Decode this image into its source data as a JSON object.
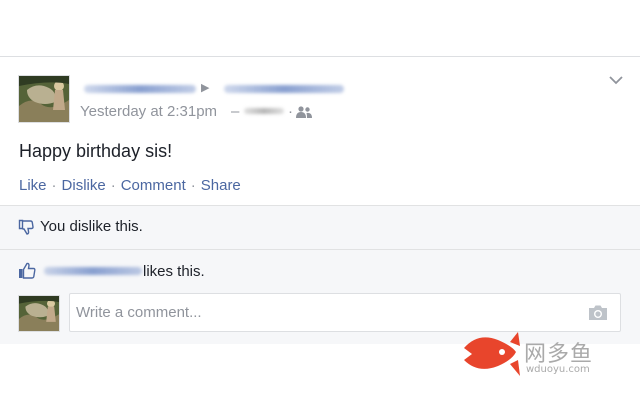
{
  "post": {
    "timestamp": "Yesterday at 2:31pm",
    "dash": "–",
    "dot": "·",
    "text": "Happy birthday sis!",
    "actions": {
      "like": "Like",
      "dislike": "Dislike",
      "comment": "Comment",
      "share": "Share",
      "separator": "·"
    }
  },
  "reactions": {
    "dislike_text": "You dislike this.",
    "likes_suffix": "likes this."
  },
  "comment": {
    "placeholder": "Write a comment..."
  },
  "watermark": {
    "cn": "网多鱼",
    "en": "wduoyu.com"
  },
  "colors": {
    "link": "#4b67a1",
    "muted": "#90949c",
    "text": "#1d2129",
    "panel": "#f6f7f9"
  },
  "icons": [
    "share-arrow-icon",
    "audience-friends-icon",
    "chevron-down-icon",
    "thumbs-down-icon",
    "thumbs-up-icon",
    "camera-icon",
    "fish-logo-icon"
  ]
}
